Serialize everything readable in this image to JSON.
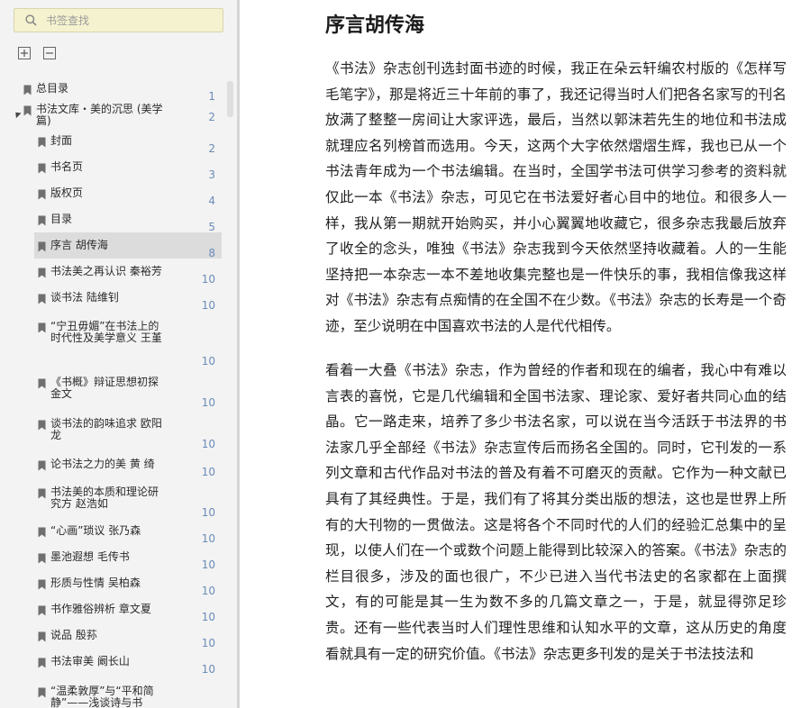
{
  "sidebar": {
    "search_placeholder": "书签查找",
    "icons": {
      "search": "search-icon",
      "expand": "expand-all-icon",
      "collapse": "collapse-all-icon",
      "bookmark": "bookmark-icon"
    },
    "items": [
      {
        "label": "总目录",
        "page": "1"
      },
      {
        "label": "书法文库・美的沉思 (美学篇)",
        "page": "2"
      },
      {
        "label": "封面",
        "page": "2"
      },
      {
        "label": "书名页",
        "page": "3"
      },
      {
        "label": "版权页",
        "page": "4"
      },
      {
        "label": "目录",
        "page": "5"
      },
      {
        "label": "序言 胡传海",
        "page": "8"
      },
      {
        "label": "书法美之再认识 秦裕芳",
        "page": "10"
      },
      {
        "label": "谈书法 陆维钊",
        "page": "10"
      },
      {
        "label": "“宁丑毋媚”在书法上的时代性及美学意义 王堇",
        "page": "10"
      },
      {
        "label": "《书概》辩证思想初探 金文",
        "page": "10"
      },
      {
        "label": "谈书法的韵味追求 欧阳龙",
        "page": "10"
      },
      {
        "label": "论书法之力的美 黄 绮",
        "page": "10"
      },
      {
        "label": "书法美的本质和理论研究方 赵浩如",
        "page": "10"
      },
      {
        "label": "“心画”琐议 张乃森",
        "page": "10"
      },
      {
        "label": "墨池遐想 毛传书",
        "page": "10"
      },
      {
        "label": "形质与性情 吴柏森",
        "page": "10"
      },
      {
        "label": "书作雅俗辨析 章文夏",
        "page": "10"
      },
      {
        "label": "说品 殷荪",
        "page": "10"
      },
      {
        "label": "书法审美 阚长山",
        "page": "10"
      },
      {
        "label": "“温柔敦厚”与“平和简静”——浅谈诗与书",
        "page": ""
      }
    ]
  },
  "content": {
    "title": "序言胡传海",
    "paragraphs": [
      "《书法》杂志创刊选封面书迹的时候，我正在朵云轩编农村版的《怎样写毛笔字》，那是将近三十年前的事了，我还记得当时人们把各名家写的刊名放满了整整一房间让大家评选，最后，当然以郭沫若先生的地位和书法成就理应名列榜首而选用。今天，这两个大字依然熠熠生辉，我也已从一个书法青年成为一个书法编辑。在当时，全国学书法可供学习参考的资料就仅此一本《书法》杂志，可见它在书法爱好者心目中的地位。和很多人一样，我从第一期就开始购买，并小心翼翼地收藏它，很多杂志我最后放弃了收全的念头，唯独《书法》杂志我到今天依然坚持收藏着。人的一生能坚持把一本杂志一本不差地收集完整也是一件快乐的事，我相信像我这样对《书法》杂志有点痴情的在全国不在少数。《书法》杂志的长寿是一个奇迹，至少说明在中国喜欢书法的人是代代相传。",
      "看着一大叠《书法》杂志，作为曾经的作者和现在的编者，我心中有难以言表的喜悦，它是几代编辑和全国书法家、理论家、爱好者共同心血的结晶。它一路走来，培养了多少书法名家，可以说在当今活跃于书法界的书法家几乎全部经《书法》杂志宣传后而扬名全国的。同时，它刊发的一系列文章和古代作品对书法的普及有着不可磨灭的贡献。它作为一种文献已具有了其经典性。于是，我们有了将其分类出版的想法，这也是世界上所有的大刊物的一贯做法。这是将各个不同时代的人们的经验汇总集中的呈现，以使人们在一个或数个问题上能得到比较深入的答案。《书法》杂志的栏目很多，涉及的面也很广，不少已进入当代书法史的名家都在上面撰文，有的可能是其一生为数不多的几篇文章之一，于是，就显得弥足珍贵。还有一些代表当时人们理性思维和认知水平的文章，这从历史的角度看就具有一定的研究价值。《书法》杂志更多刊发的是关于书法技法和"
    ]
  }
}
